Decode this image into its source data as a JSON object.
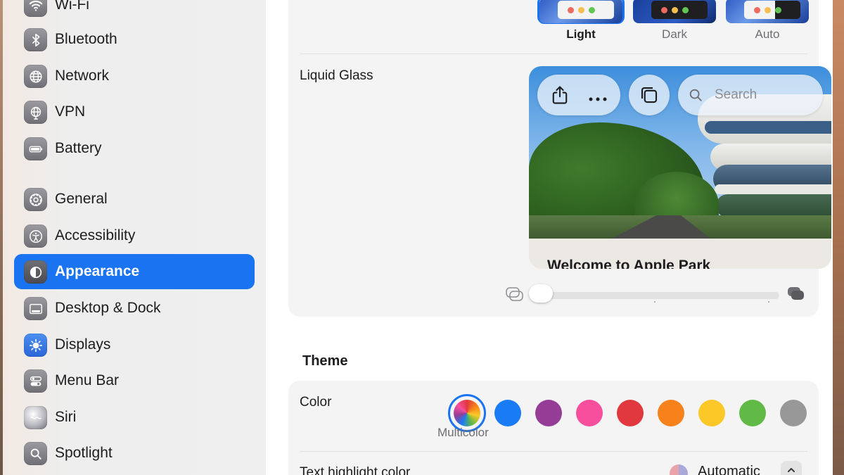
{
  "sidebar": {
    "items": [
      {
        "label": "Wi-Fi",
        "icon": "wifi-icon"
      },
      {
        "label": "Bluetooth",
        "icon": "bluetooth-icon"
      },
      {
        "label": "Network",
        "icon": "globe-icon"
      },
      {
        "label": "VPN",
        "icon": "vpn-globe-icon"
      },
      {
        "label": "Battery",
        "icon": "battery-icon"
      },
      {
        "label": "General",
        "icon": "gear-icon"
      },
      {
        "label": "Accessibility",
        "icon": "accessibility-icon"
      },
      {
        "label": "Appearance",
        "icon": "appearance-icon",
        "selected": true
      },
      {
        "label": "Desktop & Dock",
        "icon": "desktop-dock-icon"
      },
      {
        "label": "Displays",
        "icon": "brightness-icon"
      },
      {
        "label": "Menu Bar",
        "icon": "menu-bar-icon"
      },
      {
        "label": "Siri",
        "icon": "siri-icon"
      },
      {
        "label": "Spotlight",
        "icon": "search-icon"
      }
    ]
  },
  "appearance": {
    "options": [
      {
        "label": "Light",
        "selected": true
      },
      {
        "label": "Dark",
        "selected": false
      },
      {
        "label": "Auto",
        "selected": false
      }
    ]
  },
  "liquid_glass": {
    "label": "Liquid Glass",
    "search_placeholder": "Search",
    "preview_heading": "Welcome to Apple Park",
    "slider_value": 0
  },
  "theme": {
    "section_title": "Theme",
    "color_label": "Color",
    "selected_color_label": "Multicolor",
    "colors": [
      {
        "name": "multicolor",
        "hex": "multicolor",
        "selected": true
      },
      {
        "name": "blue",
        "hex": "#1a7cf5"
      },
      {
        "name": "purple",
        "hex": "#953d96"
      },
      {
        "name": "pink",
        "hex": "#f74f9e"
      },
      {
        "name": "red",
        "hex": "#e0383e"
      },
      {
        "name": "orange",
        "hex": "#f7821b"
      },
      {
        "name": "yellow",
        "hex": "#fcc827"
      },
      {
        "name": "green",
        "hex": "#62ba46"
      },
      {
        "name": "graphite",
        "hex": "#989898"
      }
    ],
    "highlight_label": "Text highlight color",
    "highlight_value": "Automatic"
  },
  "colors": {
    "accent": "#1a73f0",
    "sidebar_selected": "#1a73f0",
    "card_background": "#f4f4f4"
  }
}
